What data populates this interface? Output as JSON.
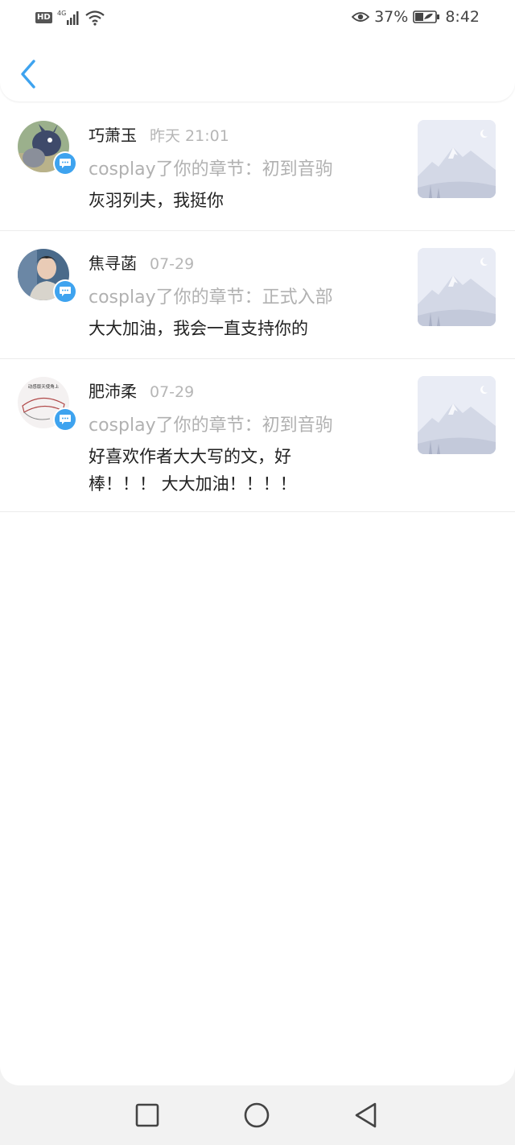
{
  "status_bar": {
    "hd_label": "HD",
    "network": "4G",
    "battery_percent": "37%",
    "time": "8:42"
  },
  "header": {
    "back_icon": "chevron-left-icon",
    "accent_color": "#3ea3ef"
  },
  "items": [
    {
      "name": "巧萧玉",
      "time": "昨天 21:01",
      "action": "cosplay了你的章节：初到音驹",
      "comment": "灰羽列夫，我挺你"
    },
    {
      "name": "焦寻菡",
      "time": "07-29",
      "action": "cosplay了你的章节：正式入部",
      "comment": "大大加油，我会一直支持你的"
    },
    {
      "name": "肥沛柔",
      "time": "07-29",
      "action": "cosplay了你的章节：初到音驹",
      "comment": "好喜欢作者大大写的文，好棒！！！ 大大加油！！！！",
      "avatar_text": "动感版天使角上"
    }
  ],
  "nav": {
    "recent_icon": "square-icon",
    "home_icon": "circle-icon",
    "back_icon": "triangle-back-icon"
  }
}
